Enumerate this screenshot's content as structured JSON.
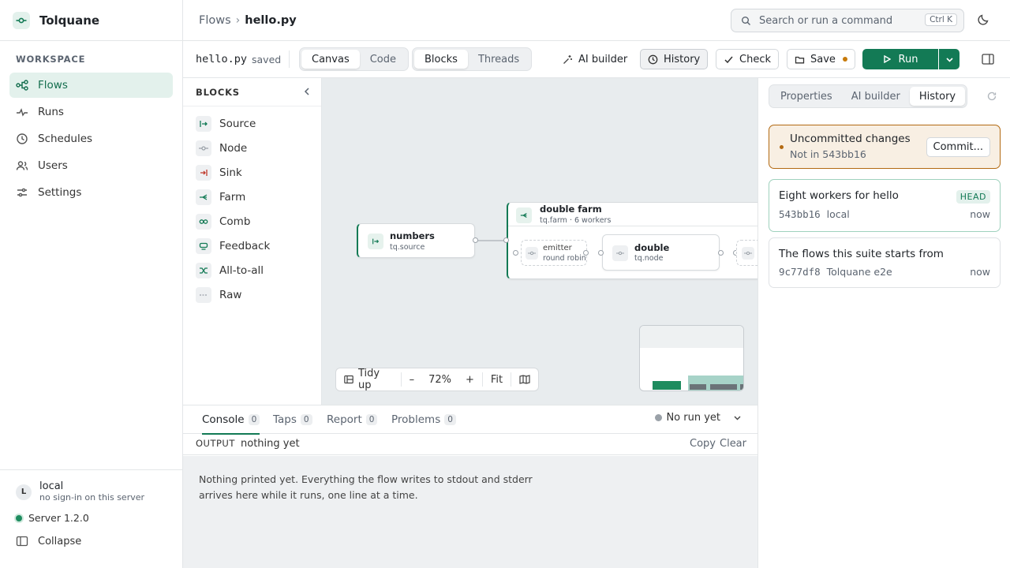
{
  "app": {
    "name": "Tolquane"
  },
  "sidebar": {
    "section_label": "WORKSPACE",
    "items": [
      {
        "label": "Flows",
        "icon": "flows-icon",
        "active": true
      },
      {
        "label": "Runs",
        "icon": "runs-icon"
      },
      {
        "label": "Schedules",
        "icon": "clock-icon"
      },
      {
        "label": "Users",
        "icon": "users-icon"
      },
      {
        "label": "Settings",
        "icon": "sliders-icon"
      }
    ],
    "user": {
      "initial": "L",
      "name": "local",
      "subtitle": "no sign-in on this server"
    },
    "server": "Server 1.2.0",
    "collapse_label": "Collapse"
  },
  "header": {
    "breadcrumb": [
      "Flows",
      "hello.py"
    ],
    "search_placeholder": "Search or run a command",
    "search_shortcut": "Ctrl K"
  },
  "toolbar": {
    "filename": "hello.py",
    "file_status": "saved",
    "view_tabs": [
      "Canvas",
      "Code"
    ],
    "active_view": "Canvas",
    "panel_tabs": [
      "Blocks",
      "Threads"
    ],
    "active_panel": "Blocks",
    "ai_builder": "AI builder",
    "history": "History",
    "check": "Check",
    "save": "Save",
    "run": "Run"
  },
  "blocks": {
    "title": "BLOCKS",
    "items": [
      {
        "label": "Source"
      },
      {
        "label": "Node"
      },
      {
        "label": "Sink"
      },
      {
        "label": "Farm"
      },
      {
        "label": "Comb"
      },
      {
        "label": "Feedback"
      },
      {
        "label": "All-to-all"
      },
      {
        "label": "Raw"
      }
    ]
  },
  "canvas": {
    "nodes": {
      "numbers": {
        "title": "numbers",
        "subtitle": "tq.source"
      },
      "farm": {
        "title": "double farm",
        "subtitle": "tq.farm · 6 workers"
      },
      "emitter": {
        "title": "emitter",
        "subtitle": "round robin"
      },
      "double": {
        "title": "double",
        "subtitle": "tq.node"
      }
    },
    "zoom": {
      "tidy": "Tidy up",
      "minus": "–",
      "level": "72%",
      "plus": "+",
      "fit": "Fit"
    }
  },
  "console": {
    "tabs": [
      {
        "label": "Console",
        "count": "0"
      },
      {
        "label": "Taps",
        "count": "0"
      },
      {
        "label": "Report",
        "count": "0"
      },
      {
        "label": "Problems",
        "count": "0"
      }
    ],
    "run_state": "No run yet",
    "output_label": "OUTPUT",
    "output_value": "nothing yet",
    "copy": "Copy",
    "clear": "Clear",
    "message": "Nothing printed yet. Everything the flow writes to stdout and stderr arrives here while it runs, one line at a time."
  },
  "right_panel": {
    "tabs": [
      "Properties",
      "AI builder",
      "History"
    ],
    "active_tab": "History",
    "uncommitted": {
      "title": "Uncommitted changes",
      "subtitle": "Not in 543bb16",
      "button": "Commit..."
    },
    "commits": [
      {
        "title": "Eight workers for hello",
        "hash": "543bb16",
        "author": "local",
        "when": "now",
        "badge": "HEAD"
      },
      {
        "title": "The flows this suite starts from",
        "hash": "9c77df8",
        "author": "Tolquane e2e",
        "when": "now"
      }
    ]
  },
  "colors": {
    "accent": "#137a55",
    "accent_soft": "#e3f1ec",
    "warning": "#b36a12",
    "canvas_bg": "#e8ecee"
  }
}
